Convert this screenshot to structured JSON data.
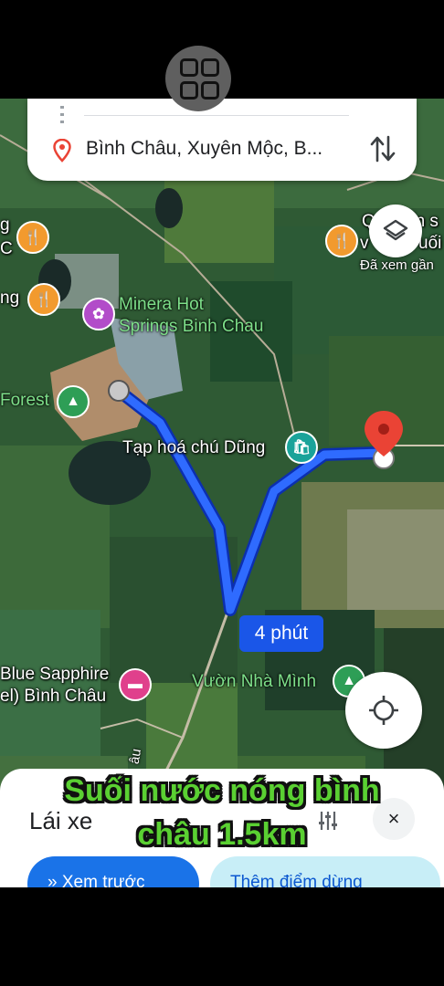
{
  "app_switcher": {
    "icon": "app-grid-icon"
  },
  "search": {
    "destination": "Bình Châu, Xuyên Mộc, B...",
    "destination_icon": "location-pin-icon",
    "swap_icon": "swap-vertical-icon"
  },
  "map": {
    "labels": {
      "minera": "Minera Hot\nSprings Binh Chau",
      "forest": "Forest",
      "taphoa": "Tạp hoá chú Dũng",
      "blue_sapphire_1": "Blue Sapphire",
      "blue_sapphire_2": "el) Bình Châu",
      "vuon": "Vườn Nhà Mình",
      "left_g": "g",
      "left_c": "C",
      "left_ng": "ng",
      "right_top": "Q",
      "right_top2": "ấn s",
      "right_v": "v",
      "right_uoi": "uối",
      "visited": "Đã xem gần",
      "road": "âu"
    },
    "route_time": "4 phút",
    "layers_icon": "layers-icon",
    "locate_icon": "my-location-icon",
    "colors": {
      "route": "#1a56e8",
      "route_border": "#0b2fb0",
      "destination_pin": "#ea4335"
    }
  },
  "bottom_sheet": {
    "mode": "Lái xe",
    "options_icon": "tune-icon",
    "close_label": "×",
    "preview_label": "»  Xem trước",
    "add_stop_label": "Thêm điểm dừng"
  },
  "caption": {
    "line1": "Suối nước nóng bình",
    "line2": "châu 1.5km"
  }
}
